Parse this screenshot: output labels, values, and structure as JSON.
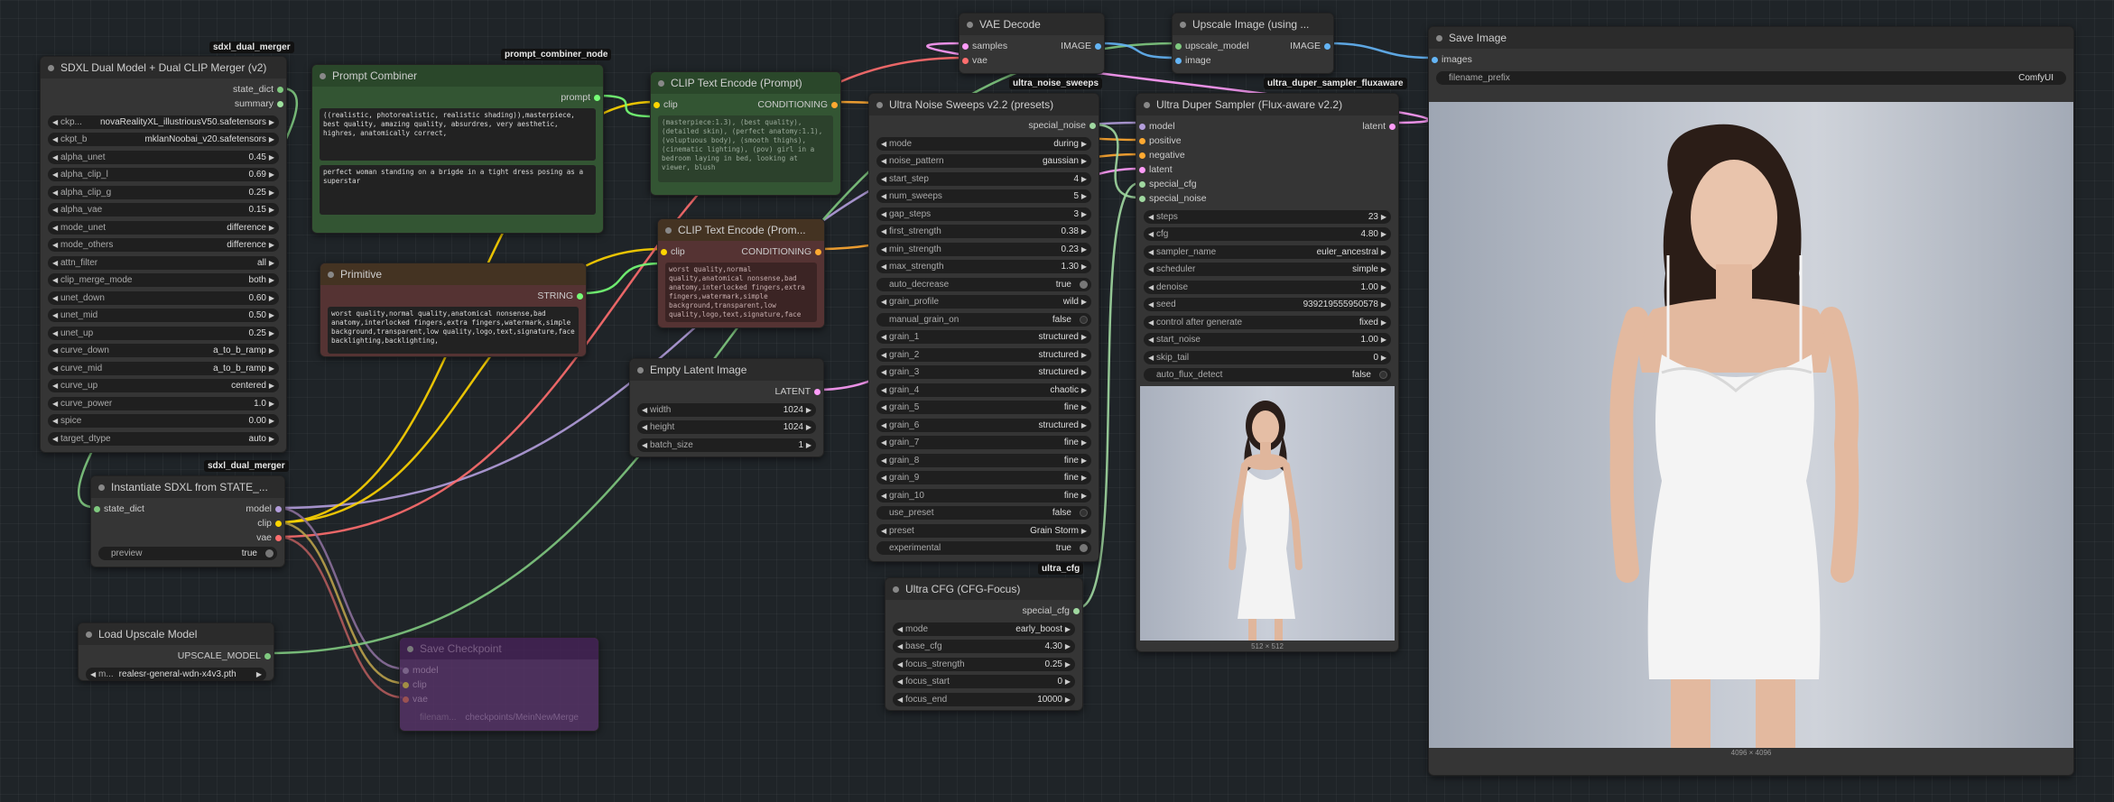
{
  "tags": {
    "sdxl_merger": "sdxl_dual_merger",
    "prompt_combiner": "prompt_combiner_node",
    "instantiate": "sdxl_dual_merger",
    "ultra_noise": "ultra_noise_sweeps",
    "ultra_duper": "ultra_duper_sampler_fluxaware",
    "ultra_cfg": "ultra_cfg"
  },
  "merger": {
    "title": "SDXL Dual Model + Dual CLIP Merger (v2)",
    "outputs": [
      "state_dict",
      "summary"
    ],
    "widgets": [
      {
        "label": "ckp...",
        "value": "novaRealityXL_illustriousV50.safetensors"
      },
      {
        "label": "ckpt_b",
        "value": "mklanNoobai_v20.safetensors"
      },
      {
        "label": "alpha_unet",
        "value": "0.45"
      },
      {
        "label": "alpha_clip_l",
        "value": "0.69"
      },
      {
        "label": "alpha_clip_g",
        "value": "0.25"
      },
      {
        "label": "alpha_vae",
        "value": "0.15"
      },
      {
        "label": "mode_unet",
        "value": "difference"
      },
      {
        "label": "mode_others",
        "value": "difference"
      },
      {
        "label": "attn_filter",
        "value": "all"
      },
      {
        "label": "clip_merge_mode",
        "value": "both"
      },
      {
        "label": "unet_down",
        "value": "0.60"
      },
      {
        "label": "unet_mid",
        "value": "0.50"
      },
      {
        "label": "unet_up",
        "value": "0.25"
      },
      {
        "label": "curve_down",
        "value": "a_to_b_ramp"
      },
      {
        "label": "curve_mid",
        "value": "a_to_b_ramp"
      },
      {
        "label": "curve_up",
        "value": "centered"
      },
      {
        "label": "curve_power",
        "value": "1.0"
      },
      {
        "label": "spice",
        "value": "0.00"
      },
      {
        "label": "target_dtype",
        "value": "auto"
      }
    ]
  },
  "instantiate": {
    "title": "Instantiate SDXL from STATE_...",
    "input": "state_dict",
    "outputs": [
      "model",
      "clip",
      "vae"
    ],
    "preview_label": "preview",
    "preview_value": "true"
  },
  "upscale_loader": {
    "title": "Load Upscale Model",
    "output": "UPSCALE_MODEL",
    "widget_label": "m...",
    "widget_value": "realesr-general-wdn-x4v3.pth"
  },
  "save_checkpoint": {
    "title": "Save Checkpoint",
    "inputs": [
      "model",
      "clip",
      "vae"
    ],
    "widget_label": "filenam...",
    "widget_value": "checkpoints/MeinNewMerge"
  },
  "prompt_combiner": {
    "title": "Prompt Combiner",
    "output": "prompt",
    "text1": "((realistic, photorealistic, realistic shading)),masterpiece, best quality, amazing quality, absurdres, very aesthetic, highres, anatomically correct,",
    "text2": "perfect woman standing on a brigde in a tight dress posing as a superstar"
  },
  "primitive": {
    "title": "Primitive",
    "output": "STRING",
    "text": "worst quality,normal quality,anatomical nonsense,bad anatomy,interlocked fingers,extra fingers,watermark,simple background,transparent,low quality,logo,text,signature,face backlighting,backlighting,"
  },
  "clip_pos": {
    "title": "CLIP Text Encode (Prompt)",
    "input": "clip",
    "output": "CONDITIONING",
    "text": "(masterpiece:1.3), (best quality), (detailed skin), (perfect anatomy:1.1), (voluptuous body), (smooth thighs), (cinematic lighting), (pov) girl in a bedroom laying in bed, looking at viewer, blush"
  },
  "clip_neg": {
    "title": "CLIP Text Encode (Prom...",
    "input": "clip",
    "output": "CONDITIONING",
    "text": "worst quality,normal quality,anatomical nonsense,bad anatomy,interlocked fingers,extra fingers,watermark,simple background,transparent,low quality,logo,text,signature,face"
  },
  "latent": {
    "title": "Empty Latent Image",
    "output": "LATENT",
    "widgets": [
      {
        "label": "width",
        "value": "1024"
      },
      {
        "label": "height",
        "value": "1024"
      },
      {
        "label": "batch_size",
        "value": "1"
      }
    ]
  },
  "vae_decode": {
    "title": "VAE Decode",
    "inputs": [
      "samples",
      "vae"
    ],
    "output": "IMAGE"
  },
  "upscale_image": {
    "title": "Upscale Image (using ...",
    "inputs": [
      "upscale_model",
      "image"
    ],
    "output": "IMAGE"
  },
  "save_image": {
    "title": "Save Image",
    "input": "images",
    "prefix_label": "filename_prefix",
    "prefix_value": "ComfyUI",
    "caption": "4096 × 4096"
  },
  "noise": {
    "title": "Ultra Noise Sweeps v2.2 (presets)",
    "output": "special_noise",
    "widgets": [
      {
        "label": "mode",
        "value": "during",
        "t": "combo"
      },
      {
        "label": "noise_pattern",
        "value": "gaussian",
        "t": "combo"
      },
      {
        "label": "start_step",
        "value": "4",
        "t": "num"
      },
      {
        "label": "num_sweeps",
        "value": "5",
        "t": "num"
      },
      {
        "label": "gap_steps",
        "value": "3",
        "t": "num"
      },
      {
        "label": "first_strength",
        "value": "0.38",
        "t": "num"
      },
      {
        "label": "min_strength",
        "value": "0.23",
        "t": "num"
      },
      {
        "label": "max_strength",
        "value": "1.30",
        "t": "num"
      },
      {
        "label": "auto_decrease",
        "value": "true",
        "t": "toggle"
      },
      {
        "label": "grain_profile",
        "value": "wild",
        "t": "combo"
      },
      {
        "label": "manual_grain_on",
        "value": "false",
        "t": "toggleoff"
      },
      {
        "label": "grain_1",
        "value": "structured",
        "t": "combo"
      },
      {
        "label": "grain_2",
        "value": "structured",
        "t": "combo"
      },
      {
        "label": "grain_3",
        "value": "structured",
        "t": "combo"
      },
      {
        "label": "grain_4",
        "value": "chaotic",
        "t": "combo"
      },
      {
        "label": "grain_5",
        "value": "fine",
        "t": "combo"
      },
      {
        "label": "grain_6",
        "value": "structured",
        "t": "combo"
      },
      {
        "label": "grain_7",
        "value": "fine",
        "t": "combo"
      },
      {
        "label": "grain_8",
        "value": "fine",
        "t": "combo"
      },
      {
        "label": "grain_9",
        "value": "fine",
        "t": "combo"
      },
      {
        "label": "grain_10",
        "value": "fine",
        "t": "combo"
      },
      {
        "label": "use_preset",
        "value": "false",
        "t": "toggleoff"
      },
      {
        "label": "preset",
        "value": "Grain Storm",
        "t": "combo"
      },
      {
        "label": "experimental",
        "value": "true",
        "t": "toggle"
      }
    ]
  },
  "cfg": {
    "title": "Ultra CFG (CFG-Focus)",
    "output": "special_cfg",
    "widgets": [
      {
        "label": "mode",
        "value": "early_boost"
      },
      {
        "label": "base_cfg",
        "value": "4.30"
      },
      {
        "label": "focus_strength",
        "value": "0.25"
      },
      {
        "label": "focus_start",
        "value": "0"
      },
      {
        "label": "focus_end",
        "value": "10000"
      }
    ]
  },
  "sampler": {
    "title": "Ultra Duper Sampler (Flux-aware v2.2)",
    "inputs": [
      "model",
      "positive",
      "negative",
      "latent",
      "special_cfg",
      "special_noise"
    ],
    "output": "latent",
    "widgets": [
      {
        "label": "steps",
        "value": "23",
        "t": "num"
      },
      {
        "label": "cfg",
        "value": "4.80",
        "t": "num"
      },
      {
        "label": "sampler_name",
        "value": "euler_ancestral",
        "t": "combo"
      },
      {
        "label": "scheduler",
        "value": "simple",
        "t": "combo"
      },
      {
        "label": "denoise",
        "value": "1.00",
        "t": "num"
      },
      {
        "label": "seed",
        "value": "939219555950578",
        "t": "num"
      },
      {
        "label": "control after generate",
        "value": "fixed",
        "t": "combo"
      },
      {
        "label": "start_noise",
        "value": "1.00",
        "t": "num"
      },
      {
        "label": "skip_tail",
        "value": "0",
        "t": "num"
      },
      {
        "label": "auto_flux_detect",
        "value": "false",
        "t": "toggleoff"
      }
    ],
    "caption": "512 × 512"
  },
  "colors": {
    "model": "#b39ddb",
    "clip": "#ffd500",
    "vae": "#ff6e6e",
    "conditioning": "#ffa931",
    "latent": "#ff9cf9",
    "image": "#64b5f6",
    "upscale": "#7fc97f",
    "string": "#77ff77",
    "special": "#a0d8a0"
  }
}
